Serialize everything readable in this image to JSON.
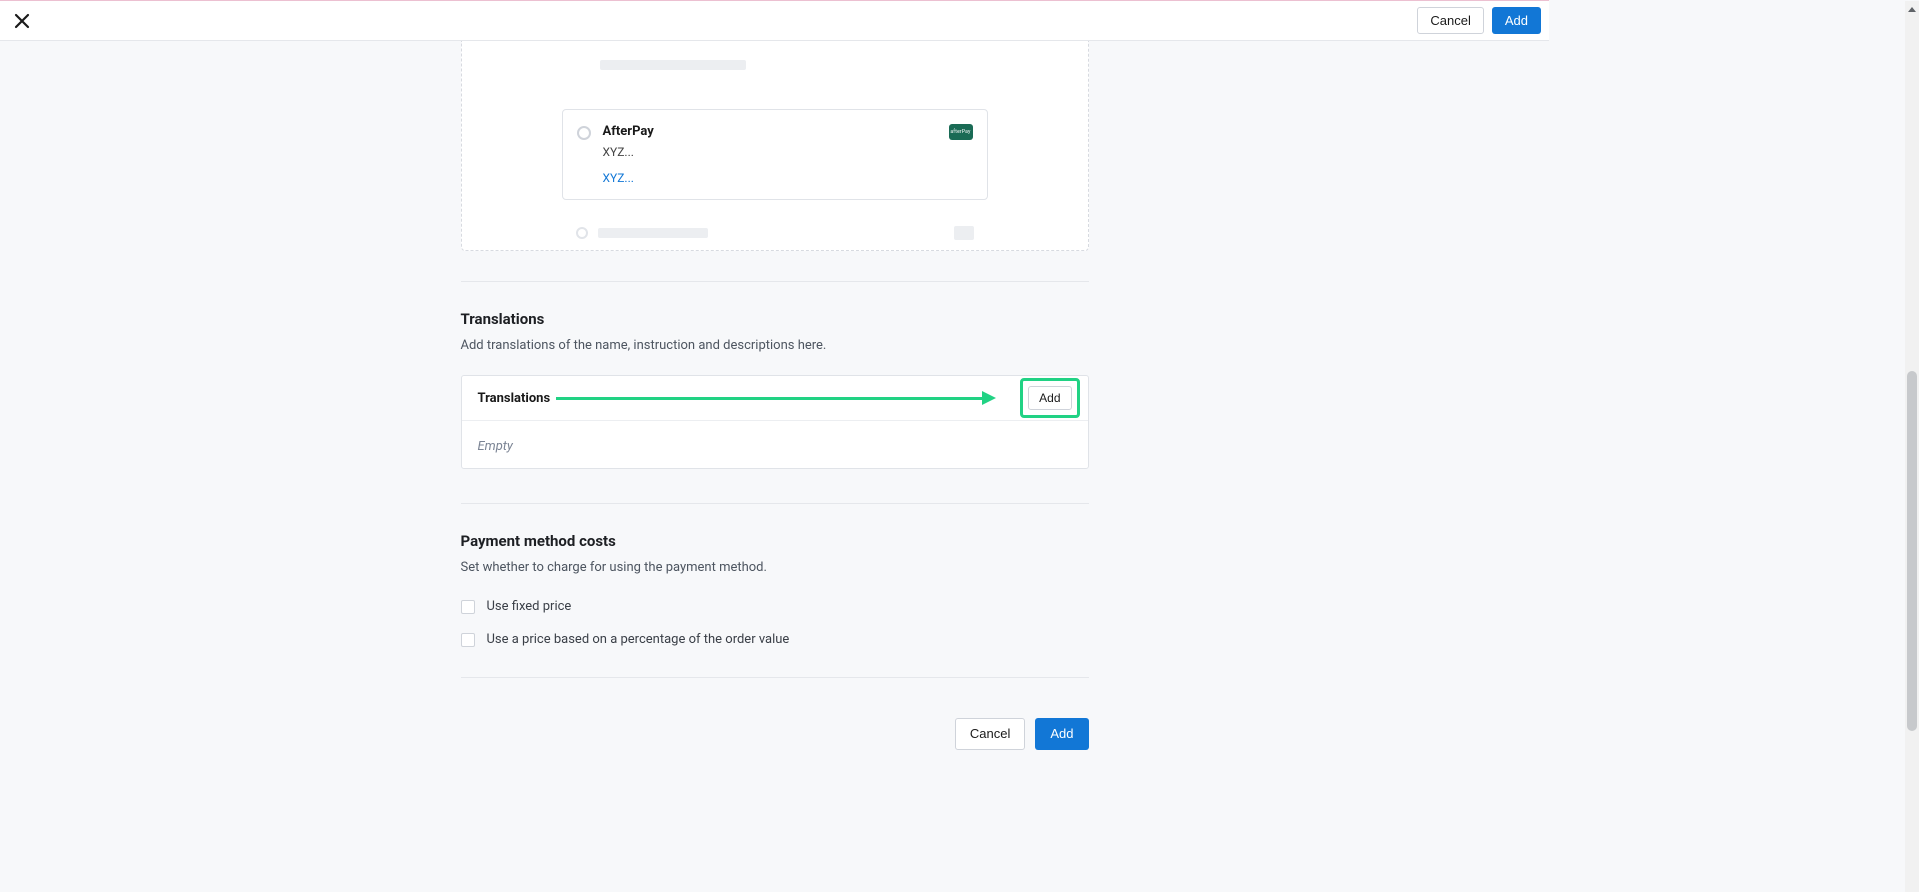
{
  "topbar": {
    "cancel_label": "Cancel",
    "add_label": "Add"
  },
  "preview": {
    "method_name": "AfterPay",
    "method_desc": "XYZ...",
    "method_link": "XYZ...",
    "badge_text": "afterPay"
  },
  "translations": {
    "section_title": "Translations",
    "section_desc": "Add translations of the name, instruction and descriptions here.",
    "card_title": "Translations",
    "add_label": "Add",
    "empty_text": "Empty"
  },
  "costs": {
    "section_title": "Payment method costs",
    "section_desc": "Set whether to charge for using the payment method.",
    "fixed_label": "Use fixed price",
    "percent_label": "Use a price based on a percentage of the order value"
  },
  "bottom": {
    "cancel_label": "Cancel",
    "add_label": "Add"
  }
}
